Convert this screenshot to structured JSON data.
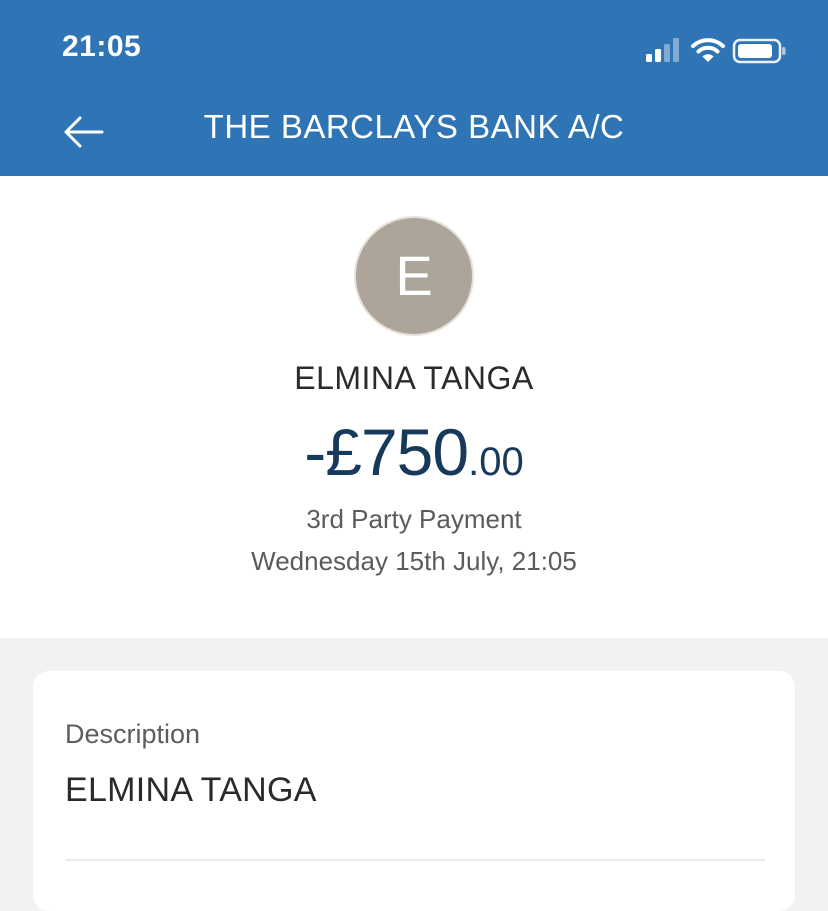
{
  "status_bar": {
    "time": "21:05"
  },
  "header": {
    "title": "THE BARCLAYS BANK A/C",
    "back_icon": "arrow-left-icon",
    "background_color": "#2f74b5"
  },
  "transaction": {
    "avatar_initial": "E",
    "payee": "ELMINA TANGA",
    "amount_main": "-£750",
    "amount_pence": ".00",
    "type": "3rd Party Payment",
    "datetime": "Wednesday 15th July, 21:05"
  },
  "details": {
    "description_label": "Description",
    "description_value": "ELMINA TANGA"
  },
  "colors": {
    "amount": "#183a5a",
    "avatar": "#ada49a",
    "page_background": "#f3f2f0"
  }
}
